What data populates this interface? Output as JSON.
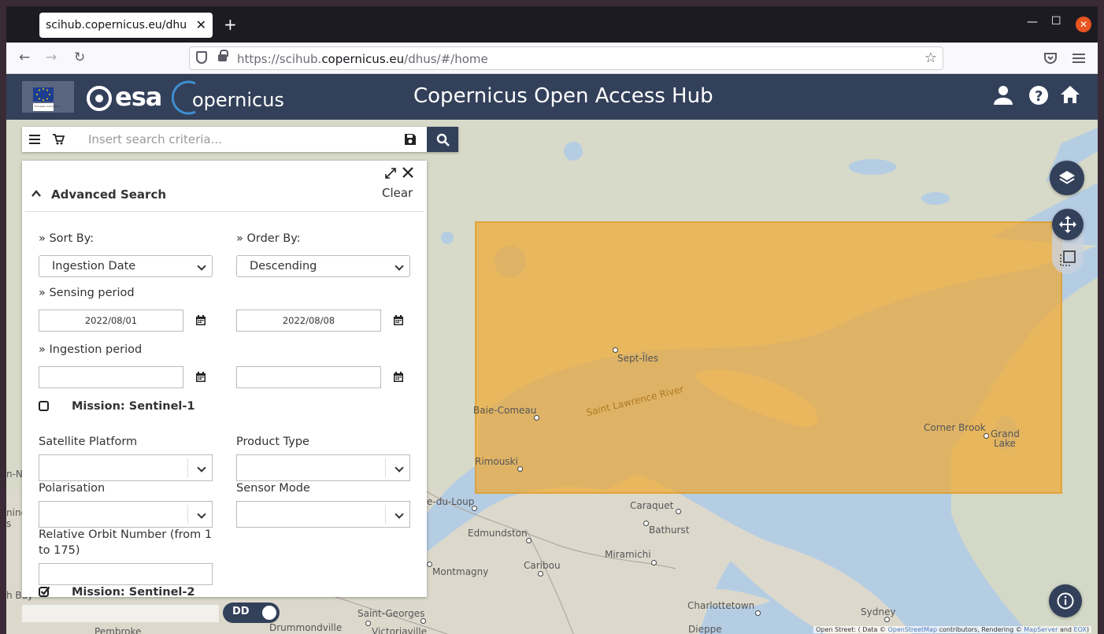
{
  "browser": {
    "tab_title": "scihub.copernicus.eu/dhus/#",
    "url_prefix": "https://scihub.",
    "url_domain": "copernicus.eu",
    "url_suffix": "/dhus/#/home"
  },
  "header": {
    "title": "Copernicus Open Access Hub",
    "ec_label": "European Commission",
    "esa_label": "esa",
    "copernicus_label": "opernicus"
  },
  "search": {
    "placeholder": "Insert search criteria..."
  },
  "advanced": {
    "title": "Advanced Search",
    "clear_label": "Clear",
    "sort_by_label": "» Sort By:",
    "sort_by_value": "Ingestion Date",
    "order_by_label": "» Order By:",
    "order_by_value": "Descending",
    "sensing_label": "» Sensing period",
    "sensing_from": "2022/08/01",
    "sensing_to": "2022/08/08",
    "ingestion_label": "» Ingestion period",
    "ingestion_from": "",
    "ingestion_to": "",
    "mission1_label": "Mission: Sentinel-1",
    "mission1_checked": false,
    "platform_label": "Satellite Platform",
    "product_type_label": "Product Type",
    "polarisation_label": "Polarisation",
    "sensor_mode_label": "Sensor Mode",
    "orbit_label_1": "Relative Orbit Number (from 1",
    "orbit_label_2": "to 175)",
    "mission2_label": "Mission: Sentinel-2",
    "mission2_checked": true
  },
  "map": {
    "coord_toggle": "DD",
    "selection_color": "#f0a830",
    "places": [
      "Sept-Îles",
      "Baie-Comeau",
      "Saint Lawrence River",
      "Rimouski",
      "Corner Brook",
      "Grand",
      "Lake",
      "Caraquet",
      "Bathurst",
      "Edmundston",
      "Miramichi",
      "Caribou",
      "Montmagny",
      "Saint-Georges",
      "Charlottetown",
      "Sydney",
      "Drummondville",
      "Victoriaville",
      "Dieppe",
      "Pembroke",
      "e-du-Loup",
      "n-Ne",
      "nine",
      "s",
      "h Bay"
    ],
    "attribution_1": "Open Street: ( Data ©",
    "attribution_2": "OpenStreetMap",
    "attribution_3": "contributors, Rendering ©",
    "attribution_4": "MapServer",
    "attribution_5": "and",
    "attribution_6": "EOX",
    "attribution_7": ")"
  },
  "colors": {
    "header_bg": "#33405a",
    "water": "#b5cde3",
    "land": "#dcd9cc"
  }
}
